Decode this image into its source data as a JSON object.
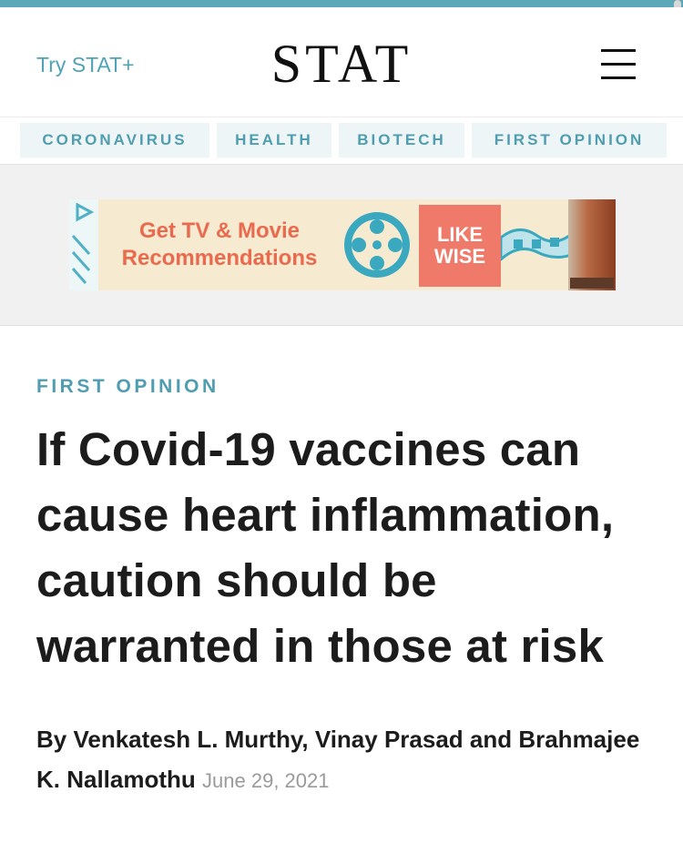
{
  "header": {
    "try_label": "Try STAT+",
    "logo": "STAT"
  },
  "nav": {
    "items": [
      {
        "label": "CORONAVIRUS"
      },
      {
        "label": "HEALTH"
      },
      {
        "label": "BIOTECH"
      },
      {
        "label": "FIRST OPINION"
      }
    ]
  },
  "ad": {
    "text": "Get TV & Movie Recommendations",
    "brand_line1": "LIKE",
    "brand_line2": "WISE"
  },
  "article": {
    "kicker": "FIRST OPINION",
    "headline": "If Covid-19 vaccines can cause heart inflammation, caution should be warranted in those at risk",
    "byline": "By Venkatesh L. Murthy, Vinay Prasad and Brahmajee K. Nallamothu",
    "date": "June 29, 2021"
  },
  "colors": {
    "accent": "#4f9db0",
    "top_rule": "#5aa8b8",
    "ad_text": "#ea6a4e",
    "ad_brand_bg": "#ef7a6a"
  }
}
